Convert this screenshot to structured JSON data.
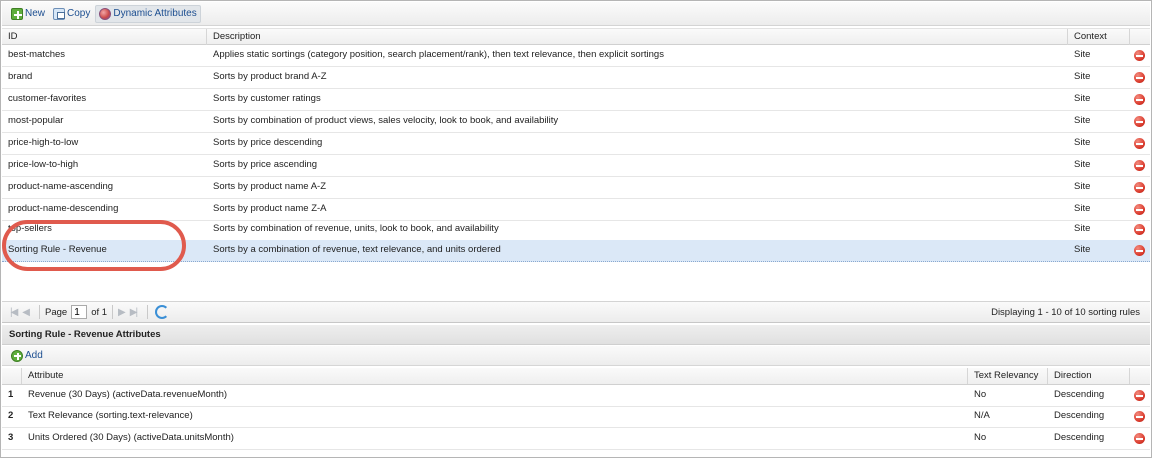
{
  "toolbar": {
    "new_label": "New",
    "copy_label": "Copy",
    "dynamic_label": "Dynamic Attributes"
  },
  "grid": {
    "columns": {
      "id": "ID",
      "description": "Description",
      "context": "Context"
    },
    "rows": [
      {
        "id": "best-matches",
        "description": "Applies static sortings (category position, search placement/rank), then text relevance, then explicit sortings",
        "context": "Site"
      },
      {
        "id": "brand",
        "description": "Sorts by product brand A-Z",
        "context": "Site"
      },
      {
        "id": "customer-favorites",
        "description": "Sorts by customer ratings",
        "context": "Site"
      },
      {
        "id": "most-popular",
        "description": "Sorts by combination of product views, sales velocity, look to book, and availability",
        "context": "Site"
      },
      {
        "id": "price-high-to-low",
        "description": "Sorts by price descending",
        "context": "Site"
      },
      {
        "id": "price-low-to-high",
        "description": "Sorts by price ascending",
        "context": "Site"
      },
      {
        "id": "product-name-ascending",
        "description": "Sorts by product name A-Z",
        "context": "Site"
      },
      {
        "id": "product-name-descending",
        "description": "Sorts by product name Z-A",
        "context": "Site"
      },
      {
        "id": "top-sellers",
        "description": "Sorts by combination of revenue, units, look to book, and availability",
        "context": "Site"
      },
      {
        "id": "Sorting Rule - Revenue",
        "description": "Sorts by a combination of revenue, text relevance, and units ordered",
        "context": "Site"
      }
    ]
  },
  "pager": {
    "page_label": "Page",
    "page_value": "1",
    "of_label": "of 1",
    "info": "Displaying 1 - 10 of 10 sorting rules"
  },
  "attributes": {
    "title": "Sorting Rule - Revenue Attributes",
    "add_label": "Add",
    "columns": {
      "attribute": "Attribute",
      "text_relevancy": "Text Relevancy",
      "direction": "Direction"
    },
    "rows": [
      {
        "num": "1",
        "attribute": "Revenue (30 Days) (activeData.revenueMonth)",
        "text_relevancy": "No",
        "direction": "Descending"
      },
      {
        "num": "2",
        "attribute": "Text Relevance (sorting.text-relevance)",
        "text_relevancy": "N/A",
        "direction": "Descending"
      },
      {
        "num": "3",
        "attribute": "Units Ordered (30 Days) (activeData.unitsMonth)",
        "text_relevancy": "No",
        "direction": "Descending"
      }
    ]
  },
  "colors": {
    "selected_row": "#dbe8f7",
    "highlight_oval": "#e05a4d",
    "link_blue": "#1d4f91",
    "delete_red": "#d9382a"
  },
  "icons": {
    "new": "plus-square-icon",
    "copy": "copy-icon",
    "dynamic": "dynamic-attributes-icon",
    "delete": "minus-circle-icon",
    "add": "plus-circle-icon",
    "refresh": "refresh-icon"
  }
}
